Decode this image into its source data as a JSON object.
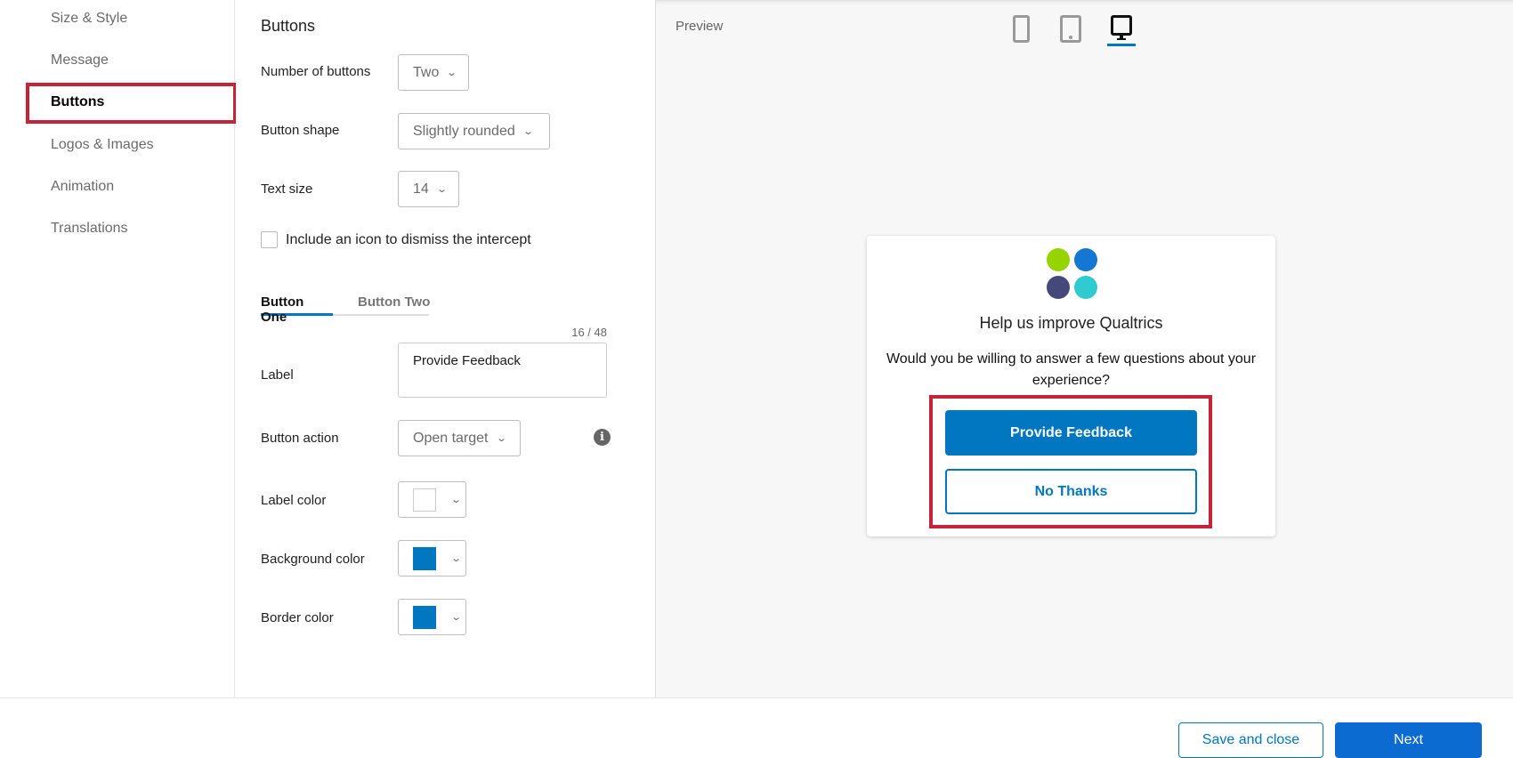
{
  "nav": {
    "items": [
      {
        "label": "Size & Style"
      },
      {
        "label": "Message"
      },
      {
        "label": "Buttons"
      },
      {
        "label": "Logos & Images"
      },
      {
        "label": "Animation"
      },
      {
        "label": "Translations"
      }
    ]
  },
  "settings": {
    "heading": "Buttons",
    "number_of_buttons": {
      "label": "Number of buttons",
      "value": "Two"
    },
    "button_shape": {
      "label": "Button shape",
      "value": "Slightly rounded"
    },
    "text_size": {
      "label": "Text size",
      "value": "14"
    },
    "dismiss_checkbox": {
      "label": "Include an icon to dismiss the intercept",
      "checked": false
    },
    "tabs": [
      {
        "label": "Button One"
      },
      {
        "label": "Button Two"
      }
    ],
    "char_count": "16 / 48",
    "label": {
      "label": "Label",
      "value": "Provide Feedback"
    },
    "button_action": {
      "label": "Button action",
      "value": "Open target"
    },
    "label_color": {
      "label": "Label color",
      "color": "#ffffff"
    },
    "background_color": {
      "label": "Background color",
      "color": "#0077c0"
    },
    "border_color": {
      "label": "Border color",
      "color": "#0077c0"
    }
  },
  "preview": {
    "label": "Preview",
    "devices": [
      "mobile-icon",
      "tablet-icon",
      "desktop-icon"
    ],
    "active_device": "desktop",
    "card": {
      "title": "Help us improve Qualtrics",
      "message": "Would you be willing to answer a few questions about your experience?",
      "button_one": "Provide Feedback",
      "button_two": "No Thanks"
    }
  },
  "footer": {
    "save_close": "Save and close",
    "next": "Next"
  },
  "colors": {
    "accent": "#0077c0",
    "highlight": "#c4233a",
    "logo": [
      "#96d400",
      "#1478d2",
      "#45497a",
      "#2fcbd1"
    ]
  }
}
